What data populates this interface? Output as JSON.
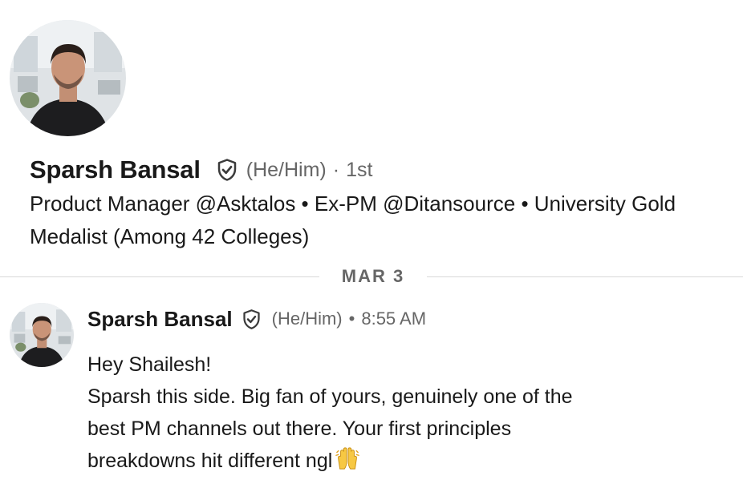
{
  "profile": {
    "name": "Sparsh Bansal",
    "pronouns": "(He/Him)",
    "separator": "·",
    "degree": "1st",
    "headline": "Product Manager @Asktalos • Ex-PM @Ditansource • University Gold Medalist (Among 42 Colleges)",
    "avatar_icon": "profile-photo",
    "badge_icon": "verified-shield-icon"
  },
  "divider": {
    "date": "MAR 3"
  },
  "message": {
    "sender": "Sparsh Bansal",
    "pronouns": "(He/Him)",
    "separator": "•",
    "time": "8:55 AM",
    "lines": [
      "Hey Shailesh!",
      "Sparsh this side. Big fan of yours, genuinely one of the",
      "best PM channels out there. Your first principles",
      "breakdowns hit different ngl"
    ],
    "emoji": "raising-hands-emoji"
  },
  "colors": {
    "primary_text": "#191919",
    "secondary_text": "#666666",
    "divider": "#d9d9d9"
  }
}
